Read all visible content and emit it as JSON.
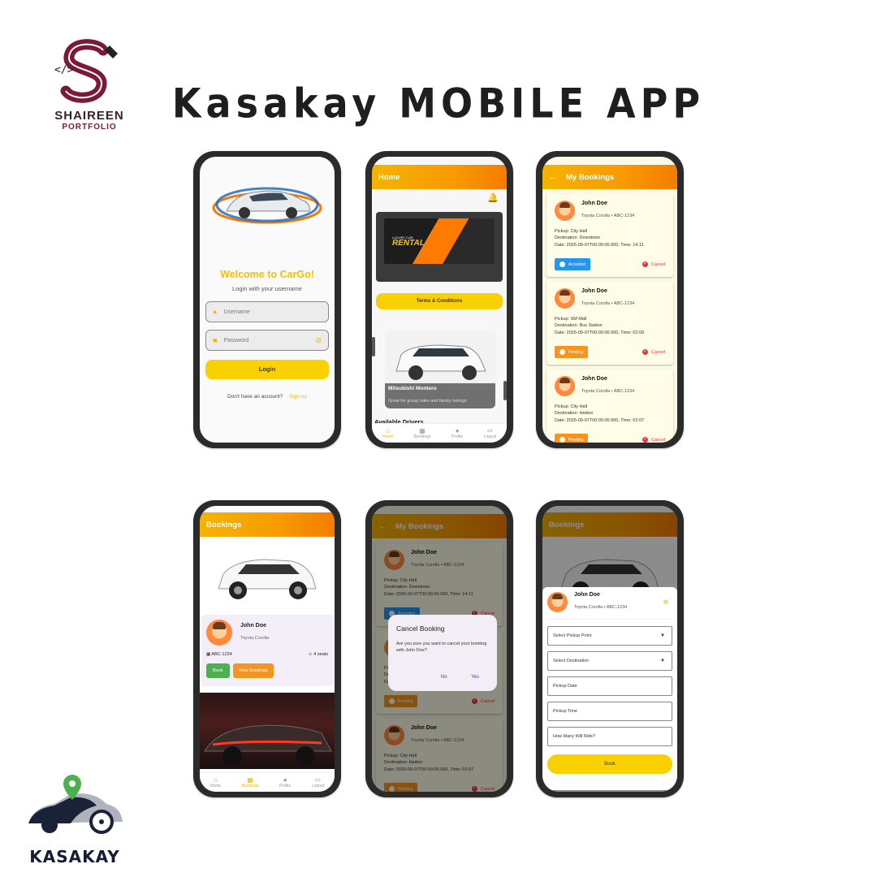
{
  "header": {
    "brand_name": "SHAIREEN",
    "brand_sub": "PORTFOLIO",
    "title": "Kasakay MOBILE APP"
  },
  "logo": {
    "name": "KASAKAY"
  },
  "login": {
    "welcome": "Welcome to CarGo!",
    "subtitle": "Login with your username",
    "username_placeholder": "Username",
    "password_placeholder": "Password",
    "login_label": "Login",
    "no_account": "Don't have an account?",
    "signup": "Sign up"
  },
  "home": {
    "title": "Home",
    "promo_line1": "LUXURY CAR",
    "promo_line2": "RENTAL",
    "terms": "Terms & Conditions",
    "car_name": "Mitsubishi Montero",
    "car_desc": "Great for group rides and family outings.",
    "available": "Available Drivers"
  },
  "nav": {
    "home": "Home",
    "bookings": "Bookings",
    "profile": "Profile",
    "logout": "Logout"
  },
  "my_bookings": {
    "title": "My Bookings",
    "cancel": "Cancel",
    "items": [
      {
        "name": "John Doe",
        "car": "Toyota Corolla • ABC-1234",
        "pickup": "Pickup: City Hall",
        "destination": "Destination: Downtown",
        "date": "Date: 2025-09-07T00:00:00.000, Time: 14:11",
        "status": "Accepted"
      },
      {
        "name": "John Doe",
        "car": "Toyota Corolla • ABC-1234",
        "pickup": "Pickup: SM Mall",
        "destination": "Destination: Bus Station",
        "date": "Date: 2025-09-07T00:00:00.000, Time: 02:09",
        "status": "Pending"
      },
      {
        "name": "John Doe",
        "car": "Toyota Corolla • ABC-1234",
        "pickup": "Pickup: City Hall",
        "destination": "Destination: Harbor",
        "date": "Date: 2025-09-07T00:00:00.000, Time: 02:07",
        "status": "Pending"
      }
    ]
  },
  "bookings": {
    "title": "Bookings",
    "driver": "John Doe",
    "car": "Toyota Corolla",
    "plate": "ABC-1234",
    "seats": "4 seats",
    "book": "Book",
    "view": "View Bookings"
  },
  "dialog": {
    "title": "Cancel Booking",
    "message": "Are you sure you want to cancel your booking with John Doe?",
    "no": "No",
    "yes": "Yes"
  },
  "sheet": {
    "name": "John Doe",
    "car": "Toyota Corolla • ABC-1234",
    "pickup_point": "Select Pickup Point",
    "destination": "Select Destination",
    "pickup_date": "Pickup Date",
    "pickup_time": "Pickup Time",
    "riders": "How Many Will Ride?",
    "book": "Book"
  }
}
